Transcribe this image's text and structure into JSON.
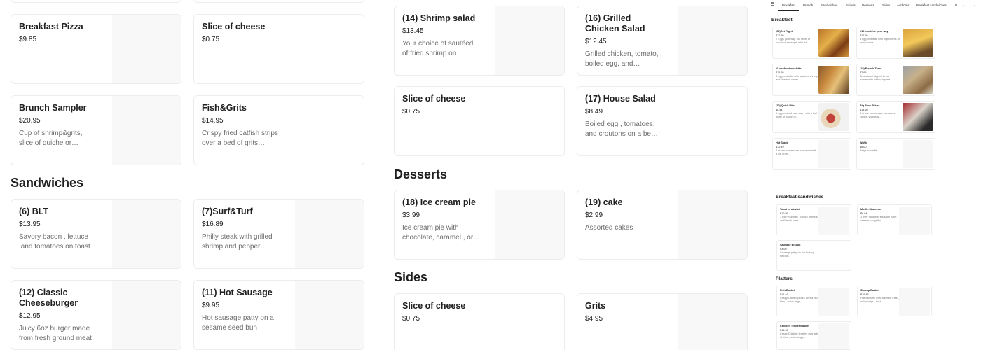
{
  "left": {
    "cards": [
      {
        "title": "Breakfast Pizza",
        "price": "$9.85",
        "desc": ""
      },
      {
        "title": "Slice of cheese",
        "price": "$0.75",
        "desc": ""
      },
      {
        "title": "Brunch Sampler",
        "price": "$20.95",
        "desc": "Cup of shrimp&grits, slice of quiche or breakfast pizza,"
      },
      {
        "title": "Fish&Grits",
        "price": "$14.95",
        "desc": "Crispy fried catfish strips over a bed of grits dressed..."
      }
    ],
    "section": "Sandwiches",
    "cards2": [
      {
        "title": "(6) BLT",
        "price": "$13.95",
        "desc": "Savory bacon , lettuce ,and tomatoes on toast"
      },
      {
        "title": "(7)Surf&Turf",
        "price": "$16.89",
        "desc": "Philly steak with grilled shrimp and pepper jack..."
      },
      {
        "title": "(12) Classic Cheeseburger",
        "price": "$12.95",
        "desc": "Juicy 6oz burger made from fresh ground meat"
      },
      {
        "title": "(11) Hot Sausage",
        "price": "$9.95",
        "desc": "Hot sausage patty on a sesame seed bun"
      }
    ]
  },
  "mid": {
    "cards": [
      {
        "title": "(14) Shrimp salad",
        "price": "$13.45",
        "desc": "Your choice of sautéed of fried shrimp on sesame,..."
      },
      {
        "title": "(16) Grilled Chicken Salad",
        "price": "$12.45",
        "desc": "Grilled chicken, tomato, boiled egg, and croutons o..."
      },
      {
        "title": "Slice of cheese",
        "price": "$0.75",
        "desc": ""
      },
      {
        "title": "(17) House Salad",
        "price": "$8.49",
        "desc": "Boiled egg , tomatoes, and croutons on a bed of lettuce"
      }
    ],
    "desserts_title": "Desserts",
    "desserts": [
      {
        "title": "(18) Ice cream pie",
        "price": "$3.99",
        "desc": "Ice cream pie with chocolate, caramel , or..."
      },
      {
        "title": "(19) cake",
        "price": "$2.99",
        "desc": "Assorted cakes"
      }
    ],
    "sides_title": "Sides",
    "sides": [
      {
        "title": "Slice of cheese",
        "price": "$0.75",
        "desc": ""
      },
      {
        "title": "Grits",
        "price": "$4.95",
        "desc": ""
      }
    ]
  },
  "right": {
    "tabs": [
      "Breakfast",
      "Brunch",
      "Sandwiches",
      "Salads",
      "Desserts",
      "Sides",
      "Add Ons",
      "Breakfast sandwiches",
      "P"
    ],
    "sec1": "Breakfast",
    "items1": [
      {
        "n": "(25)Get Right",
        "p": "$12.95",
        "d": "2 Eggs your way, full order of bacon or sausage, with ed..."
      },
      {
        "n": "#10 omelette your way",
        "p": "$12.95",
        "d": "3 egg omelette with ingredients of your choice..."
      },
      {
        "n": "#5 seafood omelette",
        "p": "$15.95",
        "d": "3 egg omelette with sautéed shrimp and cheddar chees..."
      },
      {
        "n": "(15) French Toast",
        "p": "$7.95",
        "d": "Texas toast dipped in our homemade batter, topped..."
      },
      {
        "n": "(20) Quick Bite",
        "p": "$8.44",
        "d": "1 egg cooked your way , with a half order of bacon or..."
      },
      {
        "n": "Big Back Brkfst",
        "p": "$14.50",
        "d": "3 of our homemade pancakes ,3eggs your way,..."
      },
      {
        "n": "Hot Stack",
        "p": "$12.49",
        "d": "4 of our homemade pancakes with a full order..."
      },
      {
        "n": "Waffle",
        "p": "$6.00",
        "d": "Belgium waffle"
      }
    ],
    "sec2": "Breakfast sandwiches",
    "items2": [
      {
        "n": "Toast w/ a twist",
        "p": "$10.95",
        "d": "1 egg your way , choice of meat , on French toast"
      },
      {
        "n": "Muffin Madness",
        "p": "$6.94",
        "d": "1 over hard egg sausage patty, cheese, on grilled..."
      },
      {
        "n": "Sausage Biscuit",
        "p": "$3.00",
        "d": "Sausage patty on our buttery biscuits"
      }
    ],
    "sec3": "Platters",
    "items3": [
      {
        "n": "Fish Basket",
        "p": "$16.46",
        "d": "Crispy Catfish pieces over a bed of fries , onion rings,..."
      },
      {
        "n": "Shrimp Basket",
        "p": "$16.46",
        "d": "Fried shrimp over a bed of fries , onion rings , hush..."
      },
      {
        "n": "Chicken Tender Basket",
        "p": "$15.95",
        "d": "Crispy Chicken tenders over a bed of fries , onion rings,..."
      }
    ]
  }
}
